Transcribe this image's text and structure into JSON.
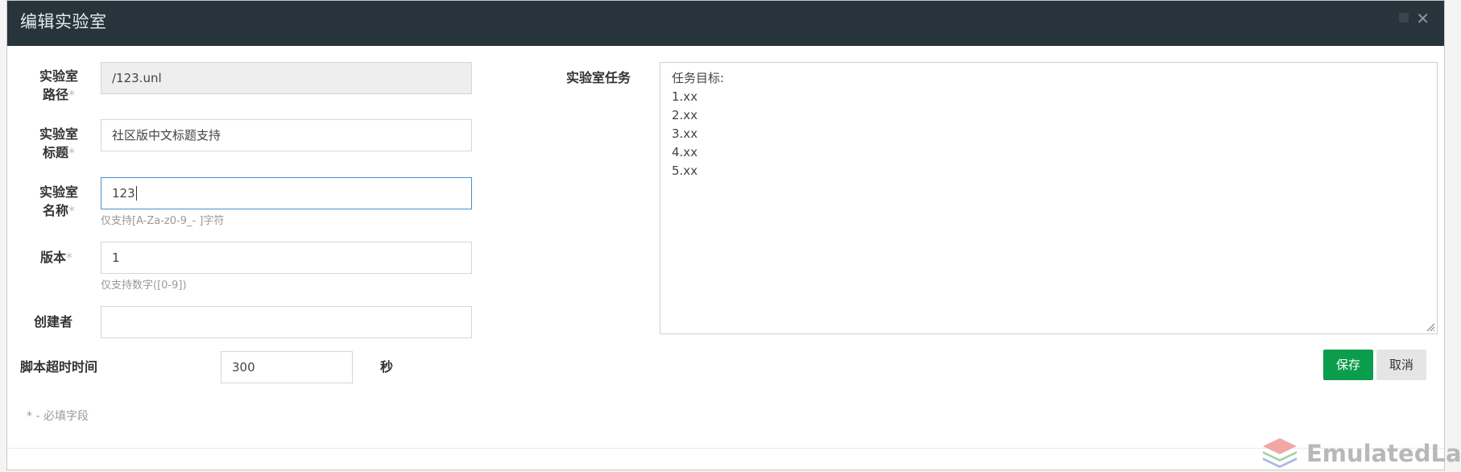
{
  "dialog": {
    "title": "编辑实验室"
  },
  "form": {
    "required_marker": "*",
    "path": {
      "label_1": "实验室",
      "label_2": "路径",
      "value": "/123.unl"
    },
    "title_field": {
      "label_1": "实验室",
      "label_2": "标题",
      "value": "社区版中文标题支持"
    },
    "name": {
      "label_1": "实验室",
      "label_2": "名称",
      "value": "123",
      "help": "仅支持[A-Za-z0-9_- ]字符"
    },
    "version": {
      "label": "版本",
      "value": "1",
      "help": "仅支持数字([0-9])"
    },
    "author": {
      "label": "创建者",
      "value": ""
    },
    "timeout": {
      "label": "脚本超时时间",
      "value": "300",
      "unit": "秒"
    },
    "task": {
      "label": "实验室任务",
      "lines": [
        "任务目标:",
        "1.xx",
        "2.xx",
        "3.xx",
        "4.xx",
        "5.xx"
      ]
    },
    "required_note": "* - 必填字段"
  },
  "buttons": {
    "save": "保存",
    "cancel": "取消"
  },
  "watermark": {
    "text": "EmulatedLab"
  },
  "colors": {
    "header": "#27343b",
    "save": "#0b9d4c",
    "focus_border": "#4a90c9"
  }
}
